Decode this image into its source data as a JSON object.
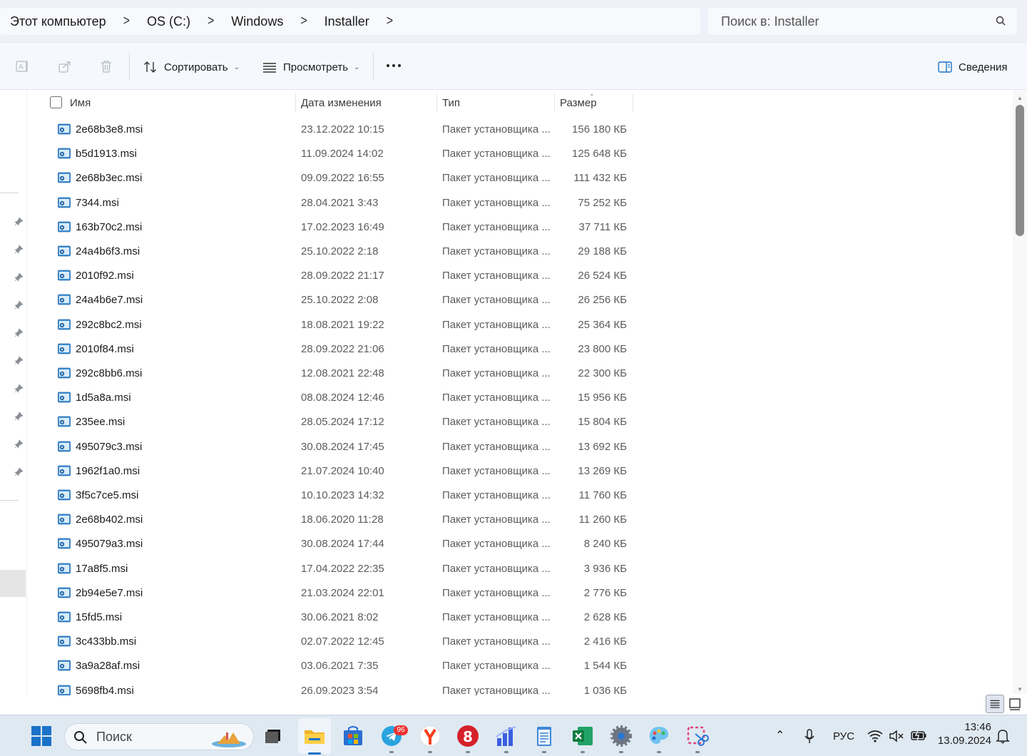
{
  "breadcrumb": {
    "items": [
      "Этот компьютер",
      "OS (C:)",
      "Windows",
      "Installer"
    ],
    "separator": ">"
  },
  "search": {
    "placeholder": "Поиск в: Installer"
  },
  "toolbar": {
    "sort_label": "Сортировать",
    "view_label": "Просмотреть",
    "details_label": "Сведения"
  },
  "columns": {
    "name": "Имя",
    "date": "Дата изменения",
    "type": "Тип",
    "size": "Размер"
  },
  "files": [
    {
      "name": "2e68b3e8.msi",
      "date": "23.12.2022 10:15",
      "type": "Пакет установщика ...",
      "size": "156 180 КБ"
    },
    {
      "name": "b5d1913.msi",
      "date": "11.09.2024 14:02",
      "type": "Пакет установщика ...",
      "size": "125 648 КБ"
    },
    {
      "name": "2e68b3ec.msi",
      "date": "09.09.2022 16:55",
      "type": "Пакет установщика ...",
      "size": "111 432 КБ"
    },
    {
      "name": "7344.msi",
      "date": "28.04.2021 3:43",
      "type": "Пакет установщика ...",
      "size": "75 252 КБ"
    },
    {
      "name": "163b70c2.msi",
      "date": "17.02.2023 16:49",
      "type": "Пакет установщика ...",
      "size": "37 711 КБ"
    },
    {
      "name": "24a4b6f3.msi",
      "date": "25.10.2022 2:18",
      "type": "Пакет установщика ...",
      "size": "29 188 КБ"
    },
    {
      "name": "2010f92.msi",
      "date": "28.09.2022 21:17",
      "type": "Пакет установщика ...",
      "size": "26 524 КБ"
    },
    {
      "name": "24a4b6e7.msi",
      "date": "25.10.2022 2:08",
      "type": "Пакет установщика ...",
      "size": "26 256 КБ"
    },
    {
      "name": "292c8bc2.msi",
      "date": "18.08.2021 19:22",
      "type": "Пакет установщика ...",
      "size": "25 364 КБ"
    },
    {
      "name": "2010f84.msi",
      "date": "28.09.2022 21:06",
      "type": "Пакет установщика ...",
      "size": "23 800 КБ"
    },
    {
      "name": "292c8bb6.msi",
      "date": "12.08.2021 22:48",
      "type": "Пакет установщика ...",
      "size": "22 300 КБ"
    },
    {
      "name": "1d5a8a.msi",
      "date": "08.08.2024 12:46",
      "type": "Пакет установщика ...",
      "size": "15 956 КБ"
    },
    {
      "name": "235ee.msi",
      "date": "28.05.2024 17:12",
      "type": "Пакет установщика ...",
      "size": "15 804 КБ"
    },
    {
      "name": "495079c3.msi",
      "date": "30.08.2024 17:45",
      "type": "Пакет установщика ...",
      "size": "13 692 КБ"
    },
    {
      "name": "1962f1a0.msi",
      "date": "21.07.2024 10:40",
      "type": "Пакет установщика ...",
      "size": "13 269 КБ"
    },
    {
      "name": "3f5c7ce5.msi",
      "date": "10.10.2023 14:32",
      "type": "Пакет установщика ...",
      "size": "11 760 КБ"
    },
    {
      "name": "2e68b402.msi",
      "date": "18.06.2020 11:28",
      "type": "Пакет установщика ...",
      "size": "11 260 КБ"
    },
    {
      "name": "495079a3.msi",
      "date": "30.08.2024 17:44",
      "type": "Пакет установщика ...",
      "size": "8 240 КБ"
    },
    {
      "name": "17a8f5.msi",
      "date": "17.04.2022 22:35",
      "type": "Пакет установщика ...",
      "size": "3 936 КБ"
    },
    {
      "name": "2b94e5e7.msi",
      "date": "21.03.2024 22:01",
      "type": "Пакет установщика ...",
      "size": "2 776 КБ"
    },
    {
      "name": "15fd5.msi",
      "date": "30.06.2021 8:02",
      "type": "Пакет установщика ...",
      "size": "2 628 КБ"
    },
    {
      "name": "3c433bb.msi",
      "date": "02.07.2022 12:45",
      "type": "Пакет установщика ...",
      "size": "2 416 КБ"
    },
    {
      "name": "3a9a28af.msi",
      "date": "03.06.2021 7:35",
      "type": "Пакет установщика ...",
      "size": "1 544 КБ"
    },
    {
      "name": "5698fb4.msi",
      "date": "26.09.2023 3:54",
      "type": "Пакет установщика ...",
      "size": "1 036 КБ"
    }
  ],
  "taskbar": {
    "search_label": "Поиск",
    "telegram_badge": "96",
    "language": "РУС",
    "time": "13:46",
    "date": "13.09.2024",
    "apps": [
      "start-icon",
      "task-view-icon",
      "file-explorer-icon",
      "store-icon",
      "telegram-icon",
      "yandex-browser-icon",
      "app-8-icon",
      "chart-app-icon",
      "notepad-icon",
      "excel-icon",
      "settings-icon",
      "paint-icon",
      "snipping-tool-icon"
    ]
  },
  "colors": {
    "accent": "#1a73c8",
    "chrome_bg": "#eef2f8",
    "taskbar_bg": "#dfe9f2"
  }
}
